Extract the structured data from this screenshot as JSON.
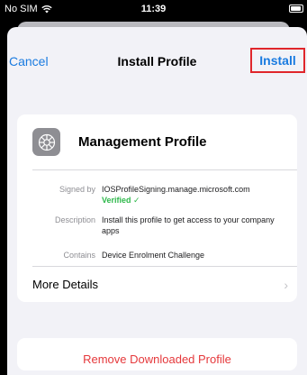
{
  "status_bar": {
    "carrier": "No SIM",
    "time": "11:39"
  },
  "nav": {
    "cancel_label": "Cancel",
    "title": "Install Profile",
    "install_label": "Install"
  },
  "profile": {
    "name": "Management Profile",
    "icon": "gear-icon",
    "signed_by_label": "Signed by",
    "signed_by_value": "IOSProfileSigning.manage.microsoft.com",
    "verified_label": "Verified ✓",
    "description_label": "Description",
    "description_value": "Install this profile to get access to your company apps",
    "contains_label": "Contains",
    "contains_value": "Device Enrolment Challenge",
    "more_details_label": "More Details"
  },
  "actions": {
    "remove_label": "Remove Downloaded Profile"
  },
  "colors": {
    "accent": "#1a7be0",
    "destructive": "#e5383b",
    "verified": "#2eb84b",
    "highlight_box": "#e0262b"
  }
}
